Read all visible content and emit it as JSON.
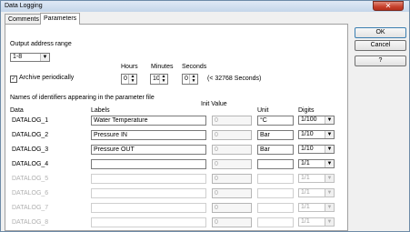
{
  "window": {
    "title": "Data Logging",
    "close_glyph": "✕"
  },
  "tabs": [
    {
      "label": "Comments"
    },
    {
      "label": "Parameters"
    }
  ],
  "buttons": {
    "ok": "OK",
    "cancel": "Cancel",
    "help": "?"
  },
  "output": {
    "label": "Output address range",
    "value": "1-8"
  },
  "archive": {
    "label": "Archive periodically",
    "checked": true,
    "hours_label": "Hours",
    "minutes_label": "Minutes",
    "seconds_label": "Seconds",
    "hours": "0",
    "minutes": "10",
    "seconds": "0",
    "limit_note": "(< 32768 Seconds)"
  },
  "table": {
    "title": "Names of identifiers appearing in the parameter file",
    "headers": {
      "data": "Data",
      "labels": "Labels",
      "init": "Init Value",
      "unit": "Unit",
      "digits": "Digits"
    },
    "rows": [
      {
        "name": "DATALOG_1",
        "label": "Water Temperature",
        "init": "0",
        "unit": "°C",
        "digits": "1/100",
        "enabled": true
      },
      {
        "name": "DATALOG_2",
        "label": "Pressure IN",
        "init": "0",
        "unit": "Bar",
        "digits": "1/10",
        "enabled": true
      },
      {
        "name": "DATALOG_3",
        "label": "Pressure OUT",
        "init": "0",
        "unit": "Bar",
        "digits": "1/10",
        "enabled": true
      },
      {
        "name": "DATALOG_4",
        "label": "",
        "init": "0",
        "unit": "",
        "digits": "1/1",
        "enabled": true
      },
      {
        "name": "DATALOG_5",
        "label": "",
        "init": "0",
        "unit": "",
        "digits": "1/1",
        "enabled": false
      },
      {
        "name": "DATALOG_6",
        "label": "",
        "init": "0",
        "unit": "",
        "digits": "1/1",
        "enabled": false
      },
      {
        "name": "DATALOG_7",
        "label": "",
        "init": "0",
        "unit": "",
        "digits": "1/1",
        "enabled": false
      },
      {
        "name": "DATALOG_8",
        "label": "",
        "init": "0",
        "unit": "",
        "digits": "1/1",
        "enabled": false
      }
    ]
  }
}
